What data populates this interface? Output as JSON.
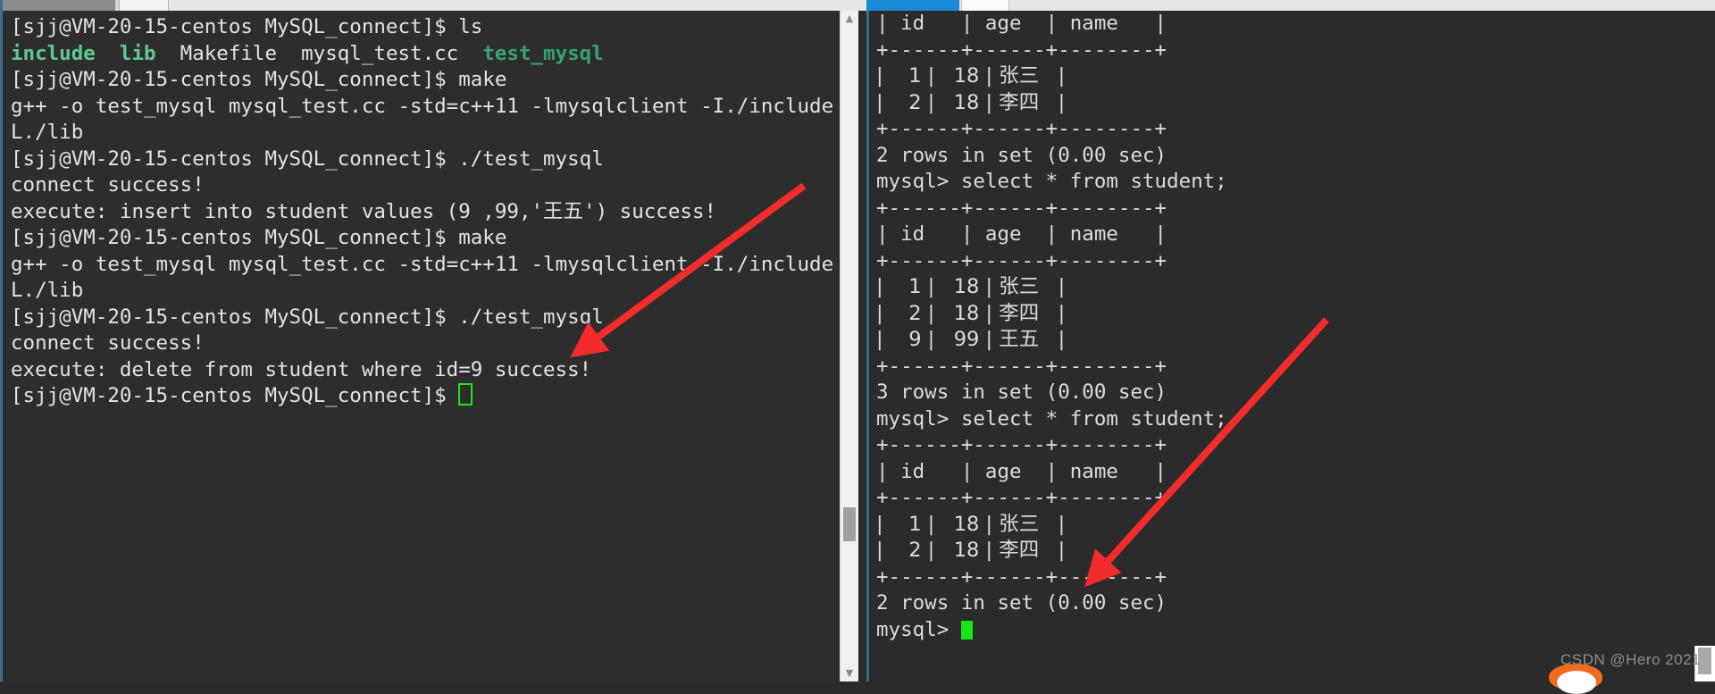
{
  "window": {
    "left_pane_name": "bash-terminal",
    "right_pane_name": "mysql-client-terminal"
  },
  "left_terminal": {
    "lines": [
      {
        "segments": [
          {
            "text": "[sjj@VM-20-15-centos MySQL_connect]$ ls",
            "style": "normal"
          }
        ]
      },
      {
        "segments": [
          {
            "text": "include",
            "style": "dir"
          },
          {
            "text": "  ",
            "style": "normal"
          },
          {
            "text": "lib",
            "style": "dir"
          },
          {
            "text": "  Makefile  mysql_test.cc  ",
            "style": "normal"
          },
          {
            "text": "test_mysql",
            "style": "exe"
          }
        ]
      },
      {
        "segments": [
          {
            "text": "[sjj@VM-20-15-centos MySQL_connect]$ make",
            "style": "normal"
          }
        ]
      },
      {
        "segments": [
          {
            "text": "g++ -o test_mysql mysql_test.cc -std=c++11 -lmysqlclient -I./include -",
            "style": "normal"
          }
        ]
      },
      {
        "segments": [
          {
            "text": "L./lib",
            "style": "normal"
          }
        ]
      },
      {
        "segments": [
          {
            "text": "[sjj@VM-20-15-centos MySQL_connect]$ ./test_mysql",
            "style": "normal"
          }
        ]
      },
      {
        "segments": [
          {
            "text": "connect success!",
            "style": "normal"
          }
        ]
      },
      {
        "segments": [
          {
            "text": "execute: insert into student values (9 ,99,'王五') success!",
            "style": "normal"
          }
        ]
      },
      {
        "segments": [
          {
            "text": "[sjj@VM-20-15-centos MySQL_connect]$ make",
            "style": "normal"
          }
        ]
      },
      {
        "segments": [
          {
            "text": "g++ -o test_mysql mysql_test.cc -std=c++11 -lmysqlclient -I./include -",
            "style": "normal"
          }
        ]
      },
      {
        "segments": [
          {
            "text": "L./lib",
            "style": "normal"
          }
        ]
      },
      {
        "segments": [
          {
            "text": "[sjj@VM-20-15-centos MySQL_connect]$ ./test_mysql",
            "style": "normal"
          }
        ]
      },
      {
        "segments": [
          {
            "text": "connect success!",
            "style": "normal"
          }
        ]
      },
      {
        "segments": [
          {
            "text": "execute: delete from student where id=9 success!",
            "style": "normal"
          }
        ]
      },
      {
        "segments": [
          {
            "text": "[sjj@VM-20-15-centos MySQL_connect]$ ",
            "style": "normal"
          },
          {
            "text": "",
            "style": "cursor"
          }
        ]
      }
    ]
  },
  "right_terminal": {
    "lines": [
      "| id   | age  | name   |",
      "+------+------+--------+",
      "|    1 |   18 | 张三   |",
      "|    2 |   18 | 李四   |",
      "+------+------+--------+",
      "2 rows in set (0.00 sec)",
      "",
      "mysql> select * from student;",
      "+------+------+--------+",
      "| id   | age  | name   |",
      "+------+------+--------+",
      "|    1 |   18 | 张三   |",
      "|    2 |   18 | 李四   |",
      "|    9 |   99 | 王五   |",
      "+------+------+--------+",
      "3 rows in set (0.00 sec)",
      "",
      "mysql> select * from student;",
      "+------+------+--------+",
      "| id   | age  | name   |",
      "+------+------+--------+",
      "|    1 |   18 | 张三   |",
      "|    2 |   18 | 李四   |",
      "+------+------+--------+",
      "2 rows in set (0.00 sec)",
      "",
      "PROMPT_CURSOR:mysql> "
    ],
    "prompt": "mysql> "
  },
  "annotations": {
    "arrow_color": "#f22b2b",
    "arrow_1_name": "arrow-pointing-to-delete-output",
    "arrow_2_name": "arrow-pointing-to-final-table"
  },
  "watermark": {
    "text": "CSDN @Hero 2021"
  },
  "colors": {
    "terminal_bg": "#2d2d2d",
    "terminal_fg": "#e3e3e3",
    "dir_color": "#5fc98f",
    "exe_color": "#36a46c",
    "cursor_green": "#19e619",
    "tab_active_blue": "#1a8ad6",
    "pane_border": "#3f6f86"
  }
}
